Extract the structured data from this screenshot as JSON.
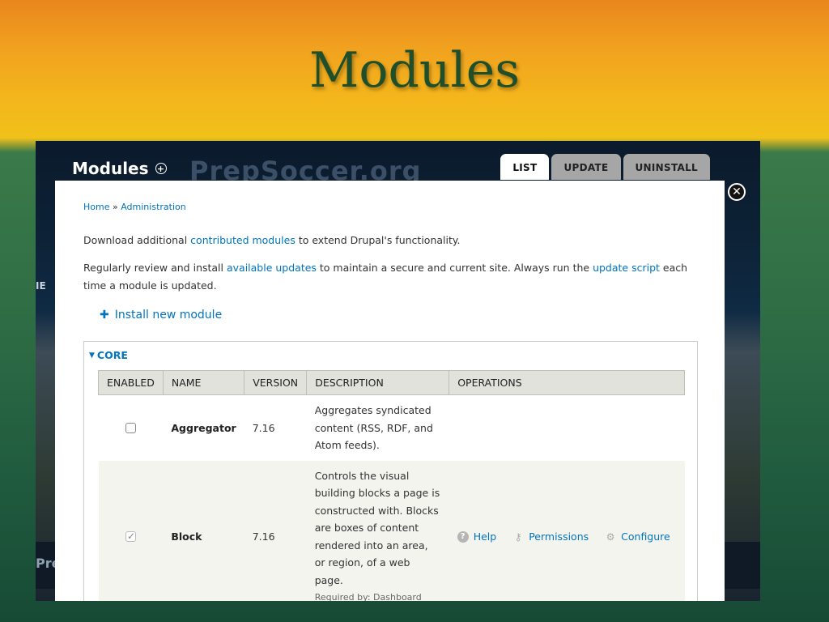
{
  "slide": {
    "title": "Modules"
  },
  "background": {
    "brand": "PrepSoccer.org",
    "left_fragment_1": "IE",
    "left_fragment_2": "Pre"
  },
  "admin": {
    "title": "Modules",
    "tabs": [
      {
        "label": "LIST",
        "active": true
      },
      {
        "label": "UPDATE",
        "active": false
      },
      {
        "label": "UNINSTALL",
        "active": false
      }
    ]
  },
  "breadcrumb": {
    "home": "Home",
    "separator": "»",
    "admin": "Administration"
  },
  "intro": {
    "p1_pre": "Download additional ",
    "p1_link": "contributed modules",
    "p1_post": " to extend Drupal's functionality.",
    "p2_pre": "Regularly review and install ",
    "p2_link1": "available updates",
    "p2_mid": " to maintain a secure and current site. Always run the ",
    "p2_link2": "update script",
    "p2_post": " each time a module is updated."
  },
  "install": {
    "label": "Install new module"
  },
  "core": {
    "label": "CORE"
  },
  "table": {
    "headers": [
      "ENABLED",
      "NAME",
      "VERSION",
      "DESCRIPTION",
      "OPERATIONS"
    ],
    "rows": [
      {
        "enabled": false,
        "name": "Aggregator",
        "version": "7.16",
        "description": "Aggregates syndicated content (RSS, RDF, and Atom feeds)."
      },
      {
        "enabled": true,
        "name": "Block",
        "version": "7.16",
        "description": "Controls the visual building blocks a page is constructed with. Blocks are boxes of content rendered into an area, or region, of a web page.",
        "required_by": "Required by: Dashboard",
        "ops": {
          "help": "Help",
          "permissions": "Permissions",
          "configure": "Configure"
        }
      }
    ]
  },
  "colors": {
    "link": "#0074bd",
    "tab_inactive": "#a6a6a6",
    "header_bg": "#e1e2dc"
  }
}
